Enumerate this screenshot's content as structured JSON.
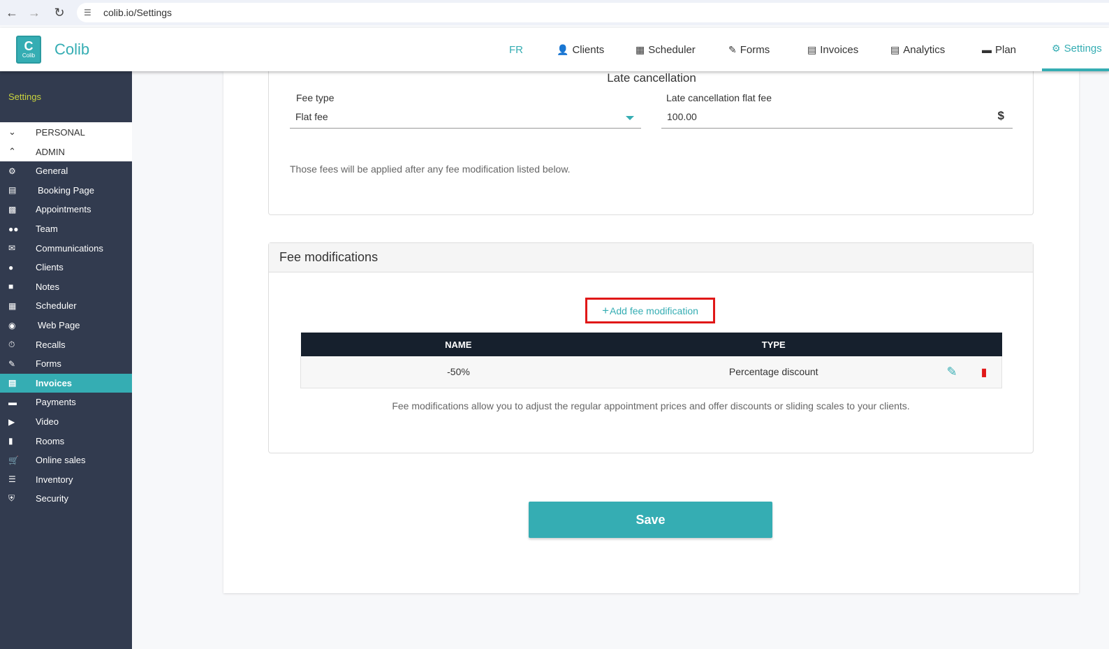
{
  "browser": {
    "url": "colib.io/Settings",
    "back_icon": "arrow-left-icon",
    "forward_icon": "arrow-right-icon",
    "reload_icon": "reload-icon"
  },
  "header": {
    "logo_letter": "C",
    "logo_text": "Colib",
    "brand": "Colib",
    "nav": [
      {
        "label": "FR",
        "icon": ""
      },
      {
        "label": "Clients",
        "icon": "user-icon"
      },
      {
        "label": "Scheduler",
        "icon": "calendar-icon"
      },
      {
        "label": "Forms",
        "icon": "signature-icon"
      },
      {
        "label": "Invoices",
        "icon": "invoice-icon"
      },
      {
        "label": "Analytics",
        "icon": "chart-icon"
      },
      {
        "label": "Plan",
        "icon": "credit-card-icon"
      },
      {
        "label": "Settings",
        "icon": "gear-icon"
      }
    ]
  },
  "sidebar": {
    "title": "Settings",
    "groups": {
      "personal": "PERSONAL",
      "admin": "ADMIN"
    },
    "items": [
      {
        "label": "General",
        "icon": "gear-icon"
      },
      {
        "label": "Booking Page",
        "icon": "clipboard-icon"
      },
      {
        "label": "Appointments",
        "icon": "address-card-icon"
      },
      {
        "label": "Team",
        "icon": "users-icon"
      },
      {
        "label": "Communications",
        "icon": "envelope-icon"
      },
      {
        "label": "Clients",
        "icon": "user-icon"
      },
      {
        "label": "Notes",
        "icon": "note-icon"
      },
      {
        "label": "Scheduler",
        "icon": "calendar-icon"
      },
      {
        "label": "Web Page",
        "icon": "globe-icon"
      },
      {
        "label": "Recalls",
        "icon": "stopwatch-icon"
      },
      {
        "label": "Forms",
        "icon": "signature-icon"
      },
      {
        "label": "Invoices",
        "icon": "invoice-icon"
      },
      {
        "label": "Payments",
        "icon": "credit-card-icon"
      },
      {
        "label": "Video",
        "icon": "video-icon"
      },
      {
        "label": "Rooms",
        "icon": "door-icon"
      },
      {
        "label": "Online sales",
        "icon": "cart-icon"
      },
      {
        "label": "Inventory",
        "icon": "list-icon"
      },
      {
        "label": "Security",
        "icon": "shield-icon"
      }
    ],
    "active_index": 11
  },
  "late_cancellation": {
    "title": "Late cancellation",
    "fee_type_label": "Fee type",
    "fee_type_value": "Flat fee",
    "flat_fee_label": "Late cancellation flat fee",
    "flat_fee_value": "100.00",
    "currency_symbol": "$",
    "note": "Those fees will be applied after any fee modification listed below."
  },
  "fee_modifications": {
    "title": "Fee modifications",
    "add_label": "Add fee modification",
    "add_plus": "+",
    "columns": {
      "name": "NAME",
      "type": "TYPE"
    },
    "rows": [
      {
        "name": "-50%",
        "type": "Percentage discount"
      }
    ],
    "note": "Fee modifications allow you to adjust the regular appointment prices and offer discounts or sliding scales to your clients."
  },
  "save_label": "Save",
  "colors": {
    "accent": "#35adb3",
    "sidebar_bg": "#323b4f",
    "danger": "#e01818",
    "table_header": "#16202d"
  }
}
